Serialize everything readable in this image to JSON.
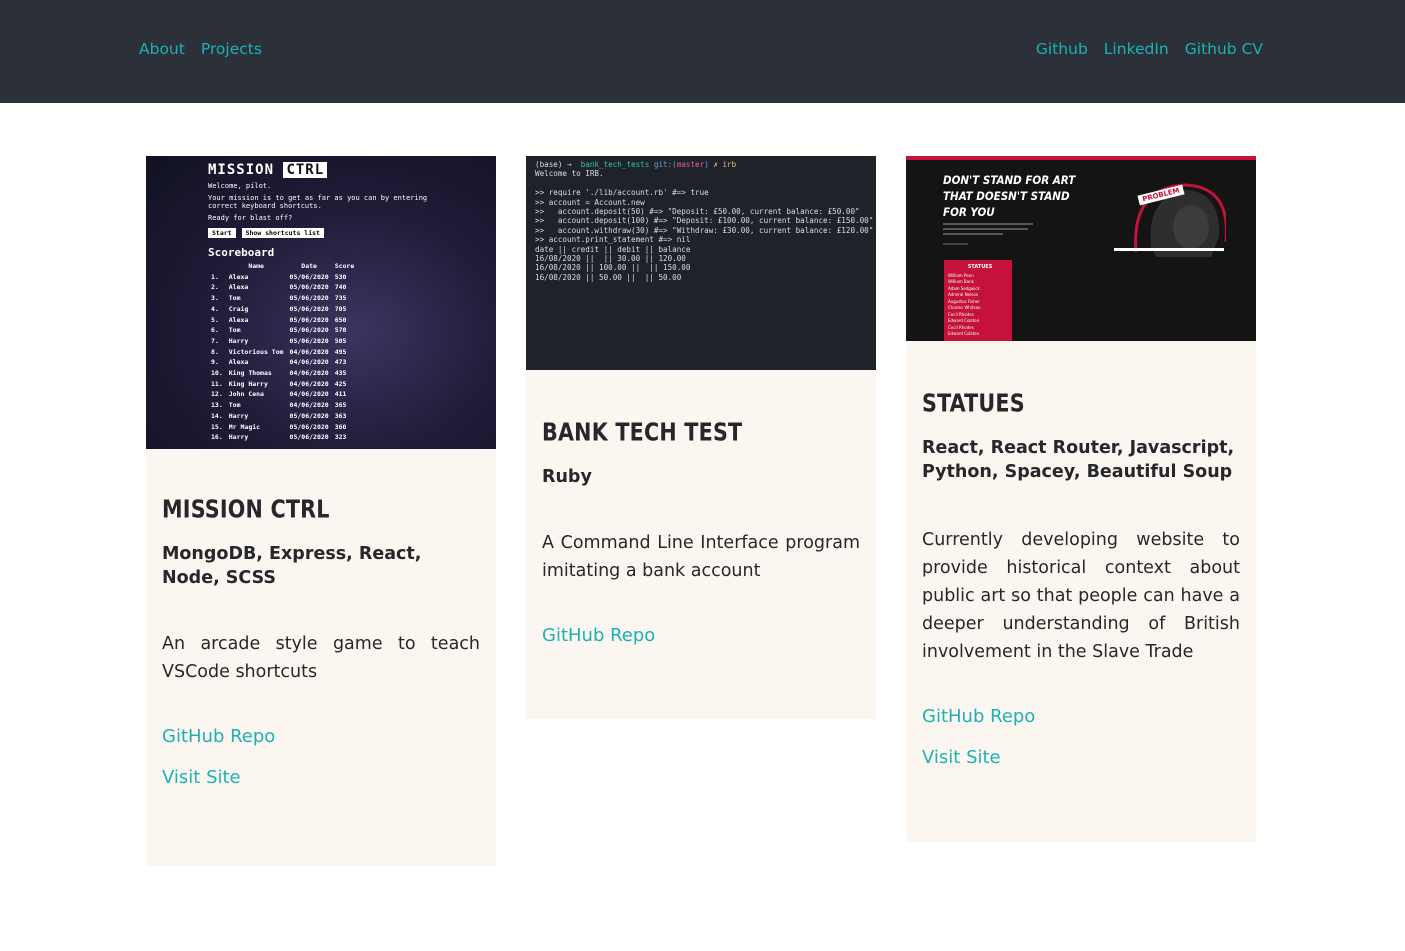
{
  "nav": {
    "left": [
      "About",
      "Projects"
    ],
    "right": [
      "Github",
      "LinkedIn",
      "Github CV"
    ]
  },
  "cards": [
    {
      "title": "MISSION CTRL",
      "tech": "MongoDB, Express, React, Node, SCSS",
      "description": "An arcade style game to teach VSCode shortcuts",
      "repo_label": "GitHub Repo",
      "site_label": "Visit Site",
      "screenshot": {
        "heading_a": "MISSION",
        "heading_b": "CTRL",
        "welcome": "Welcome, pilot.",
        "mission": "Your mission is to get as far as you can by entering correct keyboard shortcuts.",
        "ready": "Ready for blast off?",
        "start_btn": "Start",
        "shortcuts_btn": "Show shortcuts list",
        "scoreboard_title": "Scoreboard",
        "columns": [
          "",
          "Name",
          "Date",
          "Score"
        ],
        "rows": [
          [
            "1.",
            "Alexa",
            "05/06/2020",
            "530"
          ],
          [
            "2.",
            "Alexa",
            "05/06/2020",
            "740"
          ],
          [
            "3.",
            "Tom",
            "05/06/2020",
            "735"
          ],
          [
            "4.",
            "Craig",
            "05/06/2020",
            "705"
          ],
          [
            "5.",
            "Alexa",
            "05/06/2020",
            "650"
          ],
          [
            "6.",
            "Tom",
            "05/06/2020",
            "570"
          ],
          [
            "7.",
            "Harry",
            "05/06/2020",
            "505"
          ],
          [
            "8.",
            "Victorious Tom",
            "04/06/2020",
            "495"
          ],
          [
            "9.",
            "Alexa",
            "04/06/2020",
            "473"
          ],
          [
            "10.",
            "King Thomas",
            "04/06/2020",
            "435"
          ],
          [
            "11.",
            "King Harry",
            "04/06/2020",
            "425"
          ],
          [
            "12.",
            "John Cena",
            "04/06/2020",
            "411"
          ],
          [
            "13.",
            "Tom",
            "04/06/2020",
            "365"
          ],
          [
            "14.",
            "Harry",
            "05/06/2020",
            "363"
          ],
          [
            "15.",
            "Mr Magic",
            "05/06/2020",
            "360"
          ],
          [
            "16.",
            "Harry",
            "05/06/2020",
            "323"
          ]
        ]
      }
    },
    {
      "title": "BANK TECH TEST",
      "tech": "Ruby",
      "description": "A Command Line Interface program imitating a bank account",
      "repo_label": "GitHub Repo",
      "screenshot": {
        "prompt_base": "(base) →",
        "prompt_dir": "bank_tech_tests",
        "prompt_git": "git:(",
        "prompt_branch": "master",
        "prompt_git_end": ")",
        "prompt_cmd": "✗ irb",
        "welcome": "Welcome to IRB.",
        "lines": [
          ">> require './lib/account.rb' #=> true",
          ">> account = Account.new",
          ">>   account.deposit(50) #=> \"Deposit: £50.00, current balance: £50.00\"",
          ">>   account.deposit(100) #=> \"Deposit: £100.00, current balance: £150.00\"",
          ">>   account.withdraw(30) #=> \"Withdraw: £30.00, current balance: £120.00\"",
          ">> account.print_statement #=> nil",
          "date || credit || debit || balance",
          "16/08/2020 ||  || 30.00 || 120.00",
          "16/08/2020 || 100.00 ||  || 150.00",
          "16/08/2020 || 50.00 ||  || 50.00"
        ]
      }
    },
    {
      "title": "STATUES",
      "tech": "React, React Router, Javascript, Python, Spacey, Beautiful Soup",
      "description": "Currently developing website to provide historical context about public art so that people can have a deeper understanding of British involvement in the Slave Trade",
      "repo_label": "GitHub Repo",
      "site_label": "Visit Site",
      "screenshot": {
        "headline_1": "DON'T STAND FOR ART",
        "headline_2": "THAT DOESN'T STAND",
        "headline_3": "FOR YOU",
        "tag": "PROBLEM",
        "box_title": "STATUES",
        "box_items": [
          "William Penn",
          "William Bank",
          "Adam Sedgwick",
          "Admiral Nelson",
          "Augustus Fisher",
          "Charles Whitson",
          "Cecil Rhodes",
          "Edward Colston",
          "Cecil Rhodes",
          "Edward Colston"
        ]
      }
    }
  ]
}
